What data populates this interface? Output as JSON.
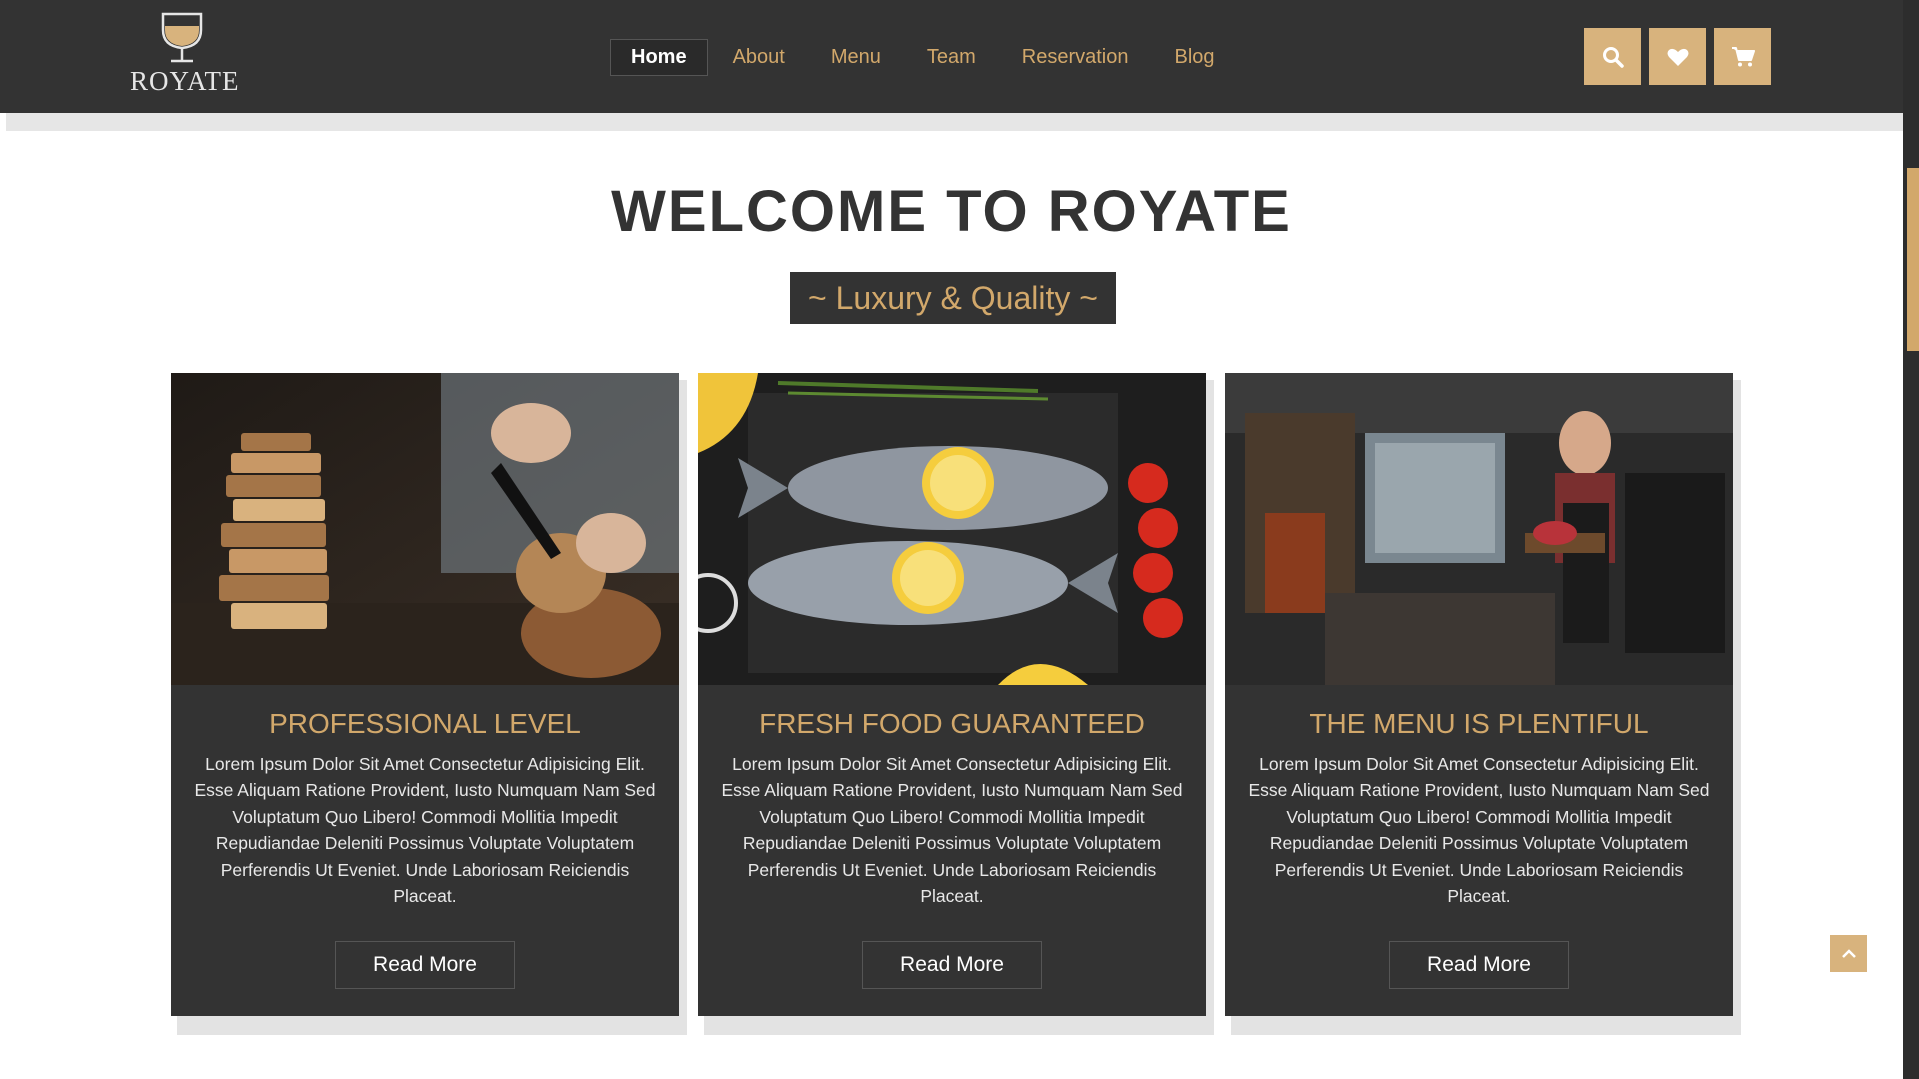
{
  "brand": {
    "name": "ROYATE",
    "accent": "#d2a86b",
    "dark": "#333333"
  },
  "nav": {
    "items": [
      {
        "label": "Home",
        "active": true
      },
      {
        "label": "About",
        "active": false
      },
      {
        "label": "Menu",
        "active": false
      },
      {
        "label": "Team",
        "active": false
      },
      {
        "label": "Reservation",
        "active": false
      },
      {
        "label": "Blog",
        "active": false
      }
    ],
    "icons": [
      "search-icon",
      "heart-icon",
      "cart-icon"
    ]
  },
  "hero": {
    "title": "WELCOME TO ROYATE",
    "subtitle": "~ Luxury & Quality ~"
  },
  "cards": [
    {
      "image": "bread-cutting-photo",
      "title": "PROFESSIONAL LEVEL",
      "text": "Lorem Ipsum Dolor Sit Amet Consectetur Adipisicing Elit. Esse Aliquam Ratione Provident, Iusto Numquam Nam Sed Voluptatum Quo Libero! Commodi Mollitia Impedit Repudiandae Deleniti Possimus Voluptate Voluptatem Perferendis Ut Eveniet. Unde Laboriosam Reiciendis Placeat.",
      "button": "Read More"
    },
    {
      "image": "fish-lemon-photo",
      "title": "FRESH FOOD GUARANTEED",
      "text": "Lorem Ipsum Dolor Sit Amet Consectetur Adipisicing Elit. Esse Aliquam Ratione Provident, Iusto Numquam Nam Sed Voluptatum Quo Libero! Commodi Mollitia Impedit Repudiandae Deleniti Possimus Voluptate Voluptatem Perferendis Ut Eveniet. Unde Laboriosam Reiciendis Placeat.",
      "button": "Read More"
    },
    {
      "image": "chef-kitchen-photo",
      "title": "THE MENU IS PLENTIFUL",
      "text": "Lorem Ipsum Dolor Sit Amet Consectetur Adipisicing Elit. Esse Aliquam Ratione Provident, Iusto Numquam Nam Sed Voluptatum Quo Libero! Commodi Mollitia Impedit Repudiandae Deleniti Possimus Voluptate Voluptatem Perferendis Ut Eveniet. Unde Laboriosam Reiciendis Placeat.",
      "button": "Read More"
    }
  ],
  "back_to_top_icon": "chevron-up-icon"
}
